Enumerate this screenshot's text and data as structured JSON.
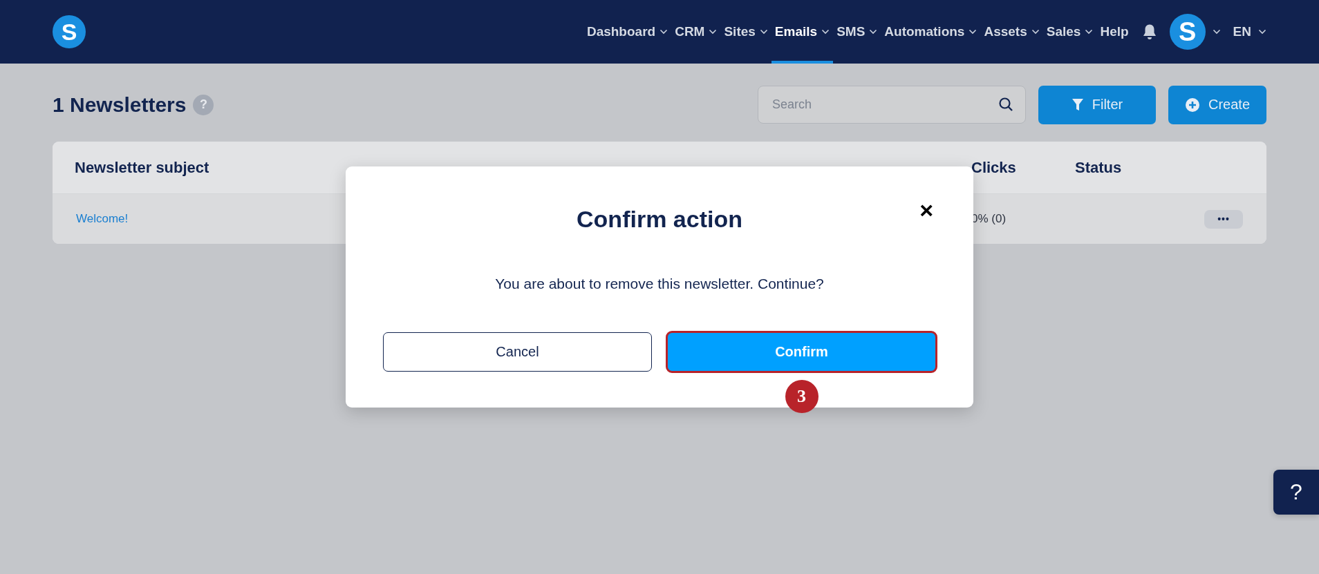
{
  "header": {
    "logo": "S",
    "nav": [
      {
        "label": "Dashboard",
        "dropdown": true,
        "selected": false
      },
      {
        "label": "CRM",
        "dropdown": true,
        "selected": false
      },
      {
        "label": "Sites",
        "dropdown": true,
        "selected": false
      },
      {
        "label": "Emails",
        "dropdown": true,
        "selected": true
      },
      {
        "label": "SMS",
        "dropdown": true,
        "selected": false
      },
      {
        "label": "Automations",
        "dropdown": true,
        "selected": false
      },
      {
        "label": "Assets",
        "dropdown": true,
        "selected": false
      },
      {
        "label": "Sales",
        "dropdown": true,
        "selected": false
      },
      {
        "label": "Help",
        "dropdown": false,
        "selected": false
      }
    ],
    "avatar": "S",
    "language": "EN"
  },
  "page": {
    "title": "1 Newsletters",
    "help": "?",
    "search": {
      "placeholder": "Search"
    },
    "buttons": [
      {
        "label": "Filter",
        "kind": "filter"
      },
      {
        "label": "Create",
        "kind": "create"
      }
    ]
  },
  "table": {
    "columns": [
      "Newsletter subject",
      "Clicks",
      "Status"
    ],
    "rows": [
      {
        "subject": "Welcome!",
        "clicks": "0% (0)",
        "more": "•••"
      }
    ]
  },
  "dialog": {
    "title": "Confirm action",
    "close": "×",
    "message": "You are about to remove this newsletter. Continue?",
    "buttons": [
      {
        "label": "Cancel",
        "kind": "secondary",
        "highlighted": false
      },
      {
        "label": "Confirm",
        "kind": "primary",
        "highlighted": true
      }
    ],
    "step_marker": "3"
  },
  "help_button": "?"
}
